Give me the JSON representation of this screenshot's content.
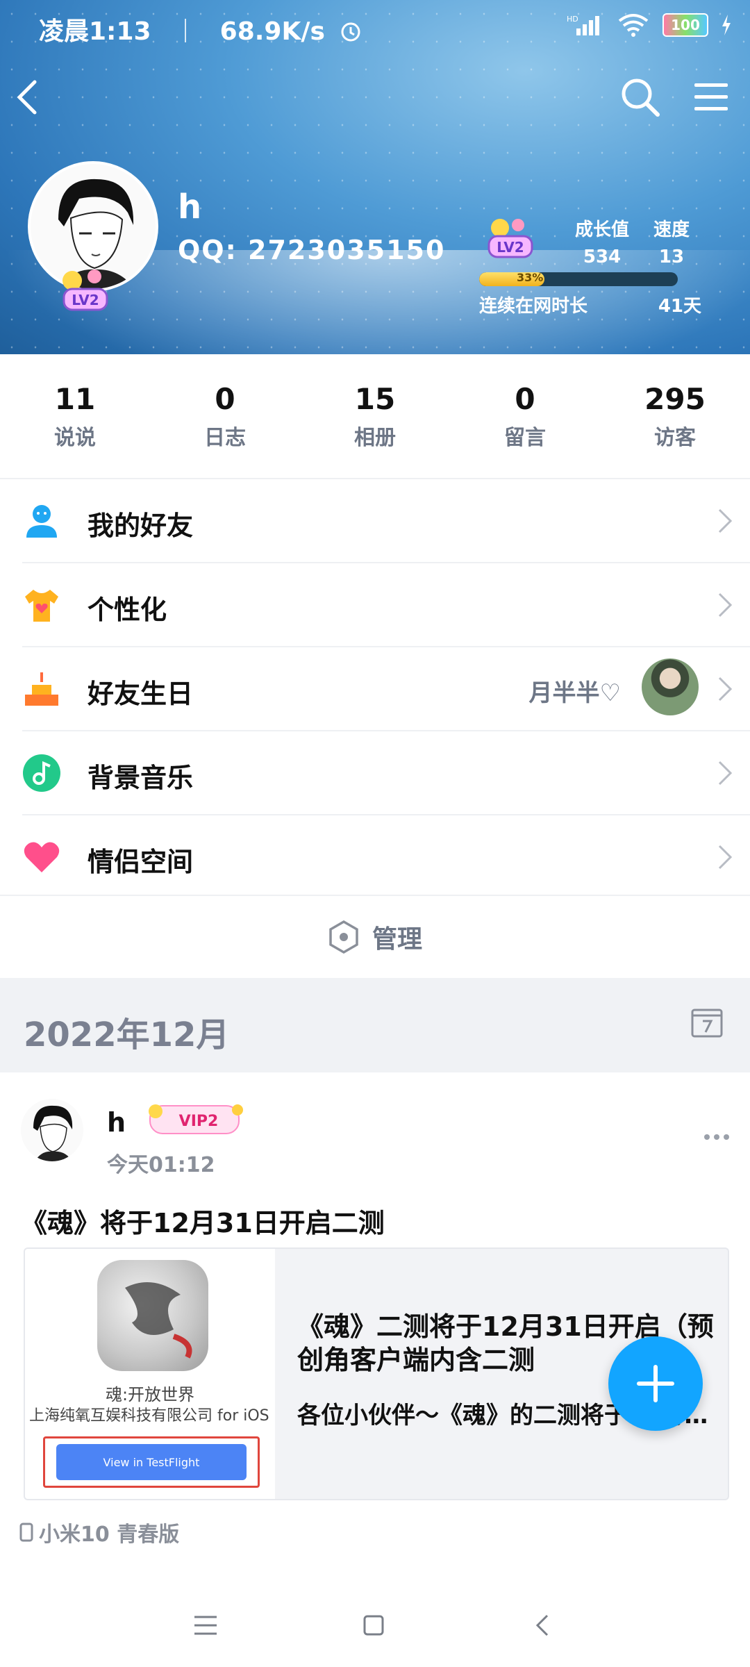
{
  "status_bar": {
    "time": "凌晨1:13",
    "speed": "68.9K/s",
    "battery": "100"
  },
  "profile": {
    "name": "h",
    "qq": "QQ: 2723035150",
    "level_badge": "LV2",
    "growth_label": "成长值",
    "growth_value": "534",
    "speed_label": "速度",
    "speed_value": "13",
    "progress_text": "33%",
    "progress": 0.33,
    "online_label": "连续在网时长",
    "online_days": "41天"
  },
  "stats": [
    {
      "value": "11",
      "label": "说说"
    },
    {
      "value": "0",
      "label": "日志"
    },
    {
      "value": "15",
      "label": "相册"
    },
    {
      "value": "0",
      "label": "留言"
    },
    {
      "value": "295",
      "label": "访客"
    }
  ],
  "menu": [
    {
      "label": "我的好友",
      "icon": "person-icon"
    },
    {
      "label": "个性化",
      "icon": "tshirt-icon"
    },
    {
      "label": "好友生日",
      "icon": "cake-icon",
      "extra": "月半半♡"
    },
    {
      "label": "背景音乐",
      "icon": "music-icon"
    },
    {
      "label": "情侣空间",
      "icon": "heart-icon"
    }
  ],
  "manage_label": "管理",
  "month_label": "2022年12月",
  "post": {
    "name": "h",
    "vip": "VIP2",
    "time": "今天01:12",
    "text": "《魂》将于12月31日开启二测",
    "card": {
      "app_name": "魂:开放世界",
      "company": "上海纯氧互娱科技有限公司 for iOS",
      "button": "View in TestFlight",
      "title": "《魂》二测将于12月31日开启（预创角客户端内含二测",
      "desc": "各位小伙伴～《魂》的二测将于12月31日开启……"
    },
    "device": "小米10 青春版"
  },
  "colors": {
    "accent": "#12a5ff",
    "muted": "#6d7686"
  }
}
